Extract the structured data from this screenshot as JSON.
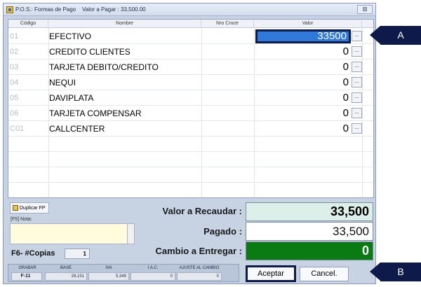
{
  "window": {
    "title": "P.O.S.: Formas de Pago    Valor a Pagar : 33,500.00",
    "close_icon": "close-x-icon",
    "close_glyph": "⊠"
  },
  "grid": {
    "headers": {
      "code": "Código",
      "name": "Nombre",
      "cross": "Nro Cruce",
      "value": "Valor"
    },
    "ellipsis": "...",
    "rows": [
      {
        "code": "01",
        "name": "EFECTIVO",
        "value": "33500"
      },
      {
        "code": "02",
        "name": "CREDITO CLIENTES",
        "value": "0"
      },
      {
        "code": "03",
        "name": "TARJETA DEBITO/CREDITO",
        "value": "0"
      },
      {
        "code": "04",
        "name": "NEQUI",
        "value": "0"
      },
      {
        "code": "05",
        "name": "DAVIPLATA",
        "value": "0"
      },
      {
        "code": "06",
        "name": "TARJETA COMPENSAR",
        "value": "0"
      },
      {
        "code": "C01",
        "name": "CALLCENTER",
        "value": "0"
      }
    ],
    "selected_row": 0
  },
  "actions": {
    "duplicate_label": "Duplicar FP",
    "note_label": "[F5] Nota:",
    "copies_label": "F6- #Copias",
    "copies_value": "1"
  },
  "summary": {
    "recaudar_label": "Valor a Recaudar :",
    "recaudar_value": "33,500",
    "pagado_label": "Pagado  :",
    "pagado_value": "33,500",
    "cambio_label": "Cambio a Entregar :",
    "cambio_value": "0"
  },
  "status": {
    "grabar_label": "GRABAR",
    "grabar_value": "F-11",
    "base_label": "BASE",
    "base_value": "28,151",
    "iva_label": "IVA",
    "iva_value": "5,349",
    "iac_label": "I.A.C.",
    "iac_value": "0",
    "ajuste_label": "AJUSTE AL CAMBIO",
    "ajuste_value": "0"
  },
  "buttons": {
    "accept": "Aceptar",
    "cancel": "Cancel."
  },
  "callouts": {
    "a": "A",
    "b": "B"
  },
  "colors": {
    "selection": "#2f7ad8",
    "callout": "#0e1a4a",
    "change_bg": "#0a7a12",
    "recaudar_bg": "#dcefe9",
    "note_bg": "#fffbdc"
  }
}
